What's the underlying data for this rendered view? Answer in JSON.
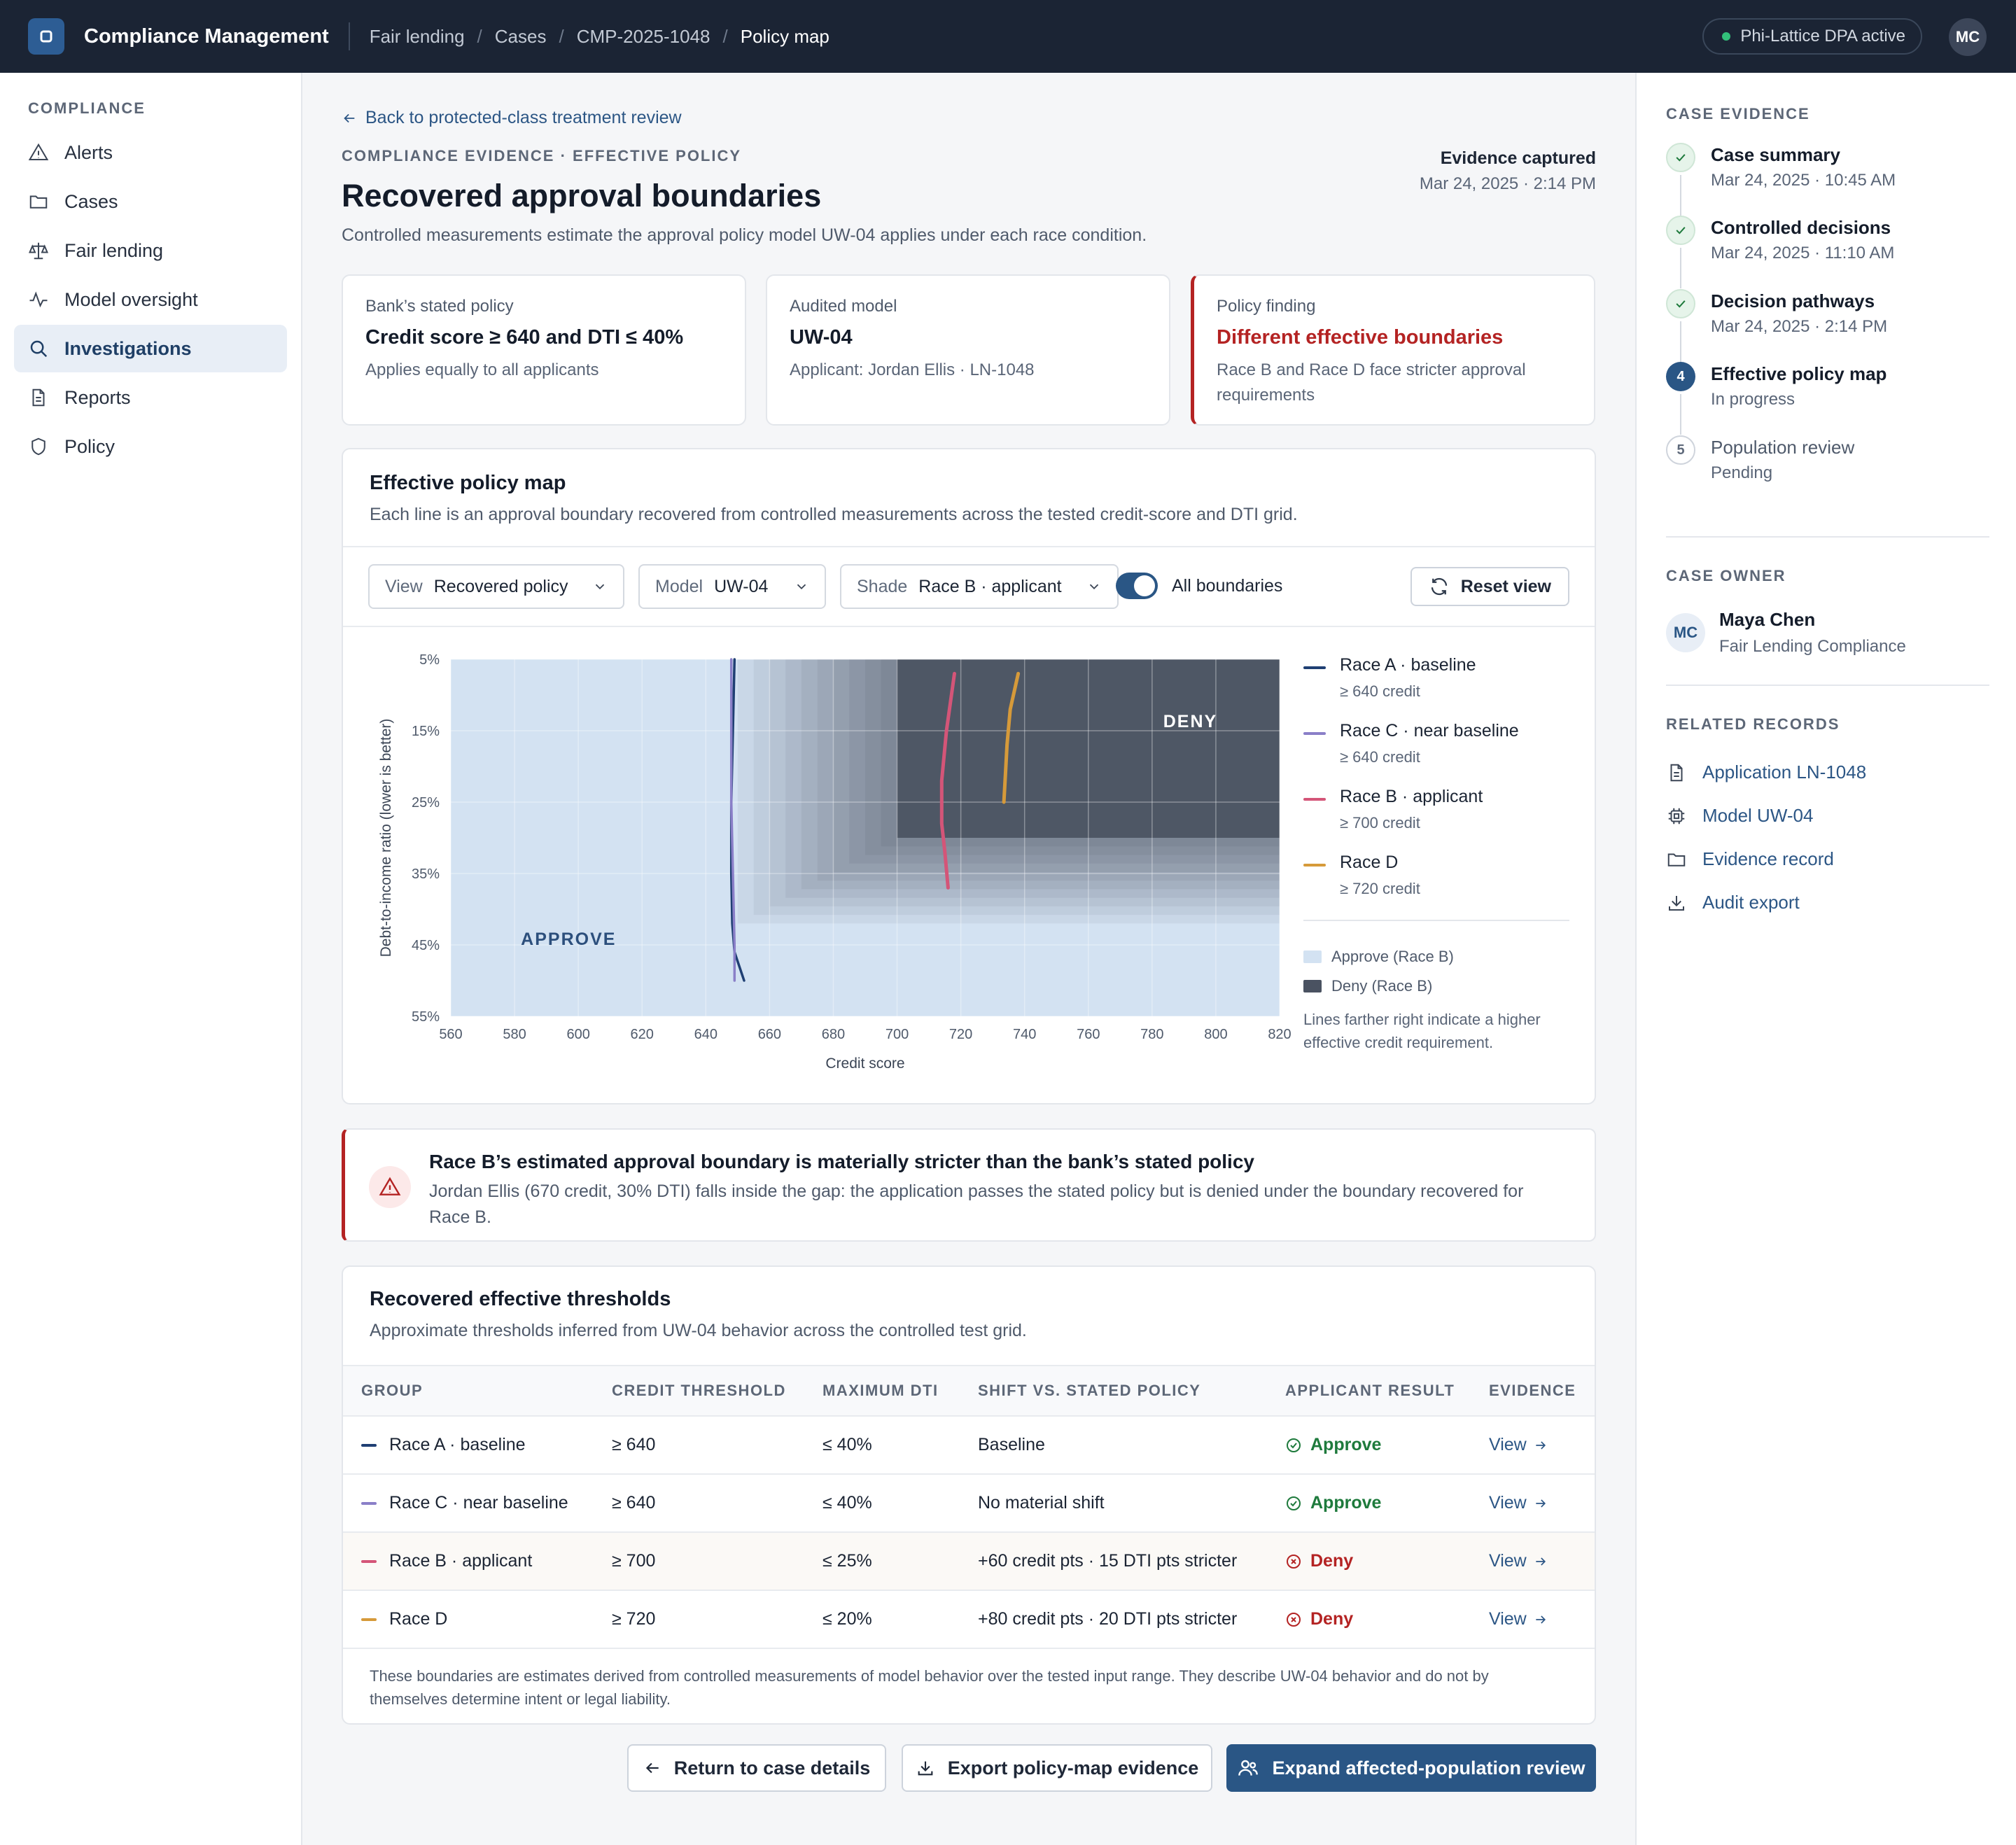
{
  "app": {
    "title": "Compliance Management"
  },
  "breadcrumbs": [
    "Fair lending",
    "Cases",
    "CMP-2025-1048",
    "Policy map"
  ],
  "status_pill": "Phi-Lattice DPA active",
  "user_initials": "MC",
  "sidebar": {
    "heading": "COMPLIANCE",
    "items": [
      {
        "label": "Alerts",
        "icon": "alert-triangle-icon"
      },
      {
        "label": "Cases",
        "icon": "folder-icon"
      },
      {
        "label": "Fair lending",
        "icon": "scale-icon"
      },
      {
        "label": "Model oversight",
        "icon": "activity-icon"
      },
      {
        "label": "Investigations",
        "icon": "search-icon",
        "active": true
      },
      {
        "label": "Reports",
        "icon": "document-icon"
      },
      {
        "label": "Policy",
        "icon": "shield-icon"
      }
    ]
  },
  "back_link": "Back to protected-class treatment review",
  "eyebrow": "COMPLIANCE EVIDENCE · EFFECTIVE POLICY",
  "page_title": "Recovered approval boundaries",
  "page_subtitle": "Controlled measurements estimate the approval policy model UW-04 applies under each race condition.",
  "evidence_captured": {
    "label": "Evidence captured",
    "date": "Mar 24, 2025 · 2:14 PM"
  },
  "summary_cards": [
    {
      "label": "Bank’s stated policy",
      "value": "Credit score ≥ 640 and DTI ≤ 40%",
      "sub": "Applies equally to all applicants"
    },
    {
      "label": "Audited model",
      "value": "UW-04",
      "sub": "Applicant: Jordan Ellis · LN-1048"
    },
    {
      "label": "Policy finding",
      "value": "Different effective boundaries",
      "sub": "Race B and Race D face stricter approval requirements"
    }
  ],
  "map_card": {
    "title": "Effective policy map",
    "subtitle": "Each line is an approval boundary recovered from controlled measurements across the tested credit-score and DTI grid.",
    "controls": {
      "view": {
        "key": "View",
        "value": "Recovered policy"
      },
      "model": {
        "key": "Model",
        "value": "UW-04"
      },
      "shade": {
        "key": "Shade",
        "value": "Race B · applicant"
      },
      "toggle_label": "All boundaries",
      "toggle_on": true,
      "reset_label": "Reset view"
    },
    "legend": {
      "items": [
        {
          "name": "Race A · baseline",
          "detail": "≥ 640 credit",
          "color": "#1f3f73"
        },
        {
          "name": "Race C · near baseline",
          "detail": "≥ 640 credit",
          "color": "#8a7fc8"
        },
        {
          "name": "Race B · applicant",
          "detail": "≥ 700 credit",
          "color": "#d45578"
        },
        {
          "name": "Race D",
          "detail": "≥ 720 credit",
          "color": "#d69a3a"
        }
      ],
      "approve_label": "Approve (Race B)",
      "deny_label": "Deny (Race B)",
      "approve_color": "#d3e2f2",
      "deny_color": "#4a5261",
      "note": "Lines farther right indicate a higher effective credit requirement."
    }
  },
  "chart_data": {
    "type": "line",
    "title": "",
    "xlabel": "Credit score",
    "ylabel": "Debt-to-income ratio (lower is better)",
    "xlim": [
      560,
      820
    ],
    "ylim": [
      5,
      55
    ],
    "y_inverted": true,
    "x_ticks": [
      "560",
      "580",
      "600",
      "620",
      "640",
      "660",
      "680",
      "700",
      "720",
      "740",
      "760",
      "780",
      "800",
      "820"
    ],
    "y_ticks": [
      "5%",
      "15%",
      "25%",
      "35%",
      "45%",
      "55%"
    ],
    "region_labels": {
      "approve": "APPROVE",
      "deny": "DENY"
    },
    "deny_region": {
      "credit_min": 700,
      "dti_max": 30
    },
    "series": [
      {
        "name": "Race A · baseline",
        "color": "#1f3f73",
        "x": [
          649,
          648.5,
          648,
          648,
          648.3,
          649,
          652
        ],
        "y": [
          5,
          15,
          25,
          35,
          42,
          46,
          50
        ]
      },
      {
        "name": "Race C · near baseline",
        "color": "#8a7fc8",
        "x": [
          648,
          648,
          648,
          648.5,
          649,
          649
        ],
        "y": [
          5,
          15,
          25,
          35,
          45,
          50
        ]
      },
      {
        "name": "Race B · applicant",
        "color": "#d45578",
        "x": [
          718,
          715.5,
          714,
          714,
          715,
          716
        ],
        "y": [
          7,
          15,
          22,
          28,
          32,
          37
        ]
      },
      {
        "name": "Race D",
        "color": "#d69a3a",
        "x": [
          738,
          735.5,
          734.5,
          734,
          733.5
        ],
        "y": [
          7,
          12,
          17,
          21,
          25
        ]
      }
    ]
  },
  "alert": {
    "title": "Race B’s estimated approval boundary is materially stricter than the bank’s stated policy",
    "body": "Jordan Ellis (670 credit, 30% DTI) falls inside the gap: the application passes the stated policy but is denied under the boundary recovered for Race B."
  },
  "thresholds": {
    "title": "Recovered effective thresholds",
    "subtitle": "Approximate thresholds inferred from UW-04 behavior across the controlled test grid.",
    "columns": [
      "GROUP",
      "CREDIT THRESHOLD",
      "MAXIMUM DTI",
      "SHIFT VS. STATED POLICY",
      "APPLICANT RESULT",
      "EVIDENCE"
    ],
    "rows": [
      {
        "group": "Race A · baseline",
        "color": "#1f3f73",
        "credit": "≥ 640",
        "dti": "≤ 40%",
        "shift": "Baseline",
        "result": "Approve",
        "status": "ok",
        "evidence": "View"
      },
      {
        "group": "Race C · near baseline",
        "color": "#8a7fc8",
        "credit": "≥ 640",
        "dti": "≤ 40%",
        "shift": "No material shift",
        "result": "Approve",
        "status": "ok",
        "evidence": "View"
      },
      {
        "group": "Race B · applicant",
        "color": "#d45578",
        "credit": "≥ 700",
        "dti": "≤ 25%",
        "shift": "+60 credit pts · 15 DTI pts stricter",
        "result": "Deny",
        "status": "bad",
        "evidence": "View"
      },
      {
        "group": "Race D",
        "color": "#d69a3a",
        "credit": "≥ 720",
        "dti": "≤ 20%",
        "shift": "+80 credit pts · 20 DTI pts stricter",
        "result": "Deny",
        "status": "bad",
        "evidence": "View"
      }
    ],
    "footnote": "These boundaries are estimates derived from controlled measurements of model behavior over the tested input range. They describe UW-04 behavior and do not by themselves determine intent or legal liability."
  },
  "actions": {
    "return": "Return to case details",
    "export": "Export policy-map evidence",
    "expand": "Expand affected-population review"
  },
  "right_panel": {
    "evidence_heading": "CASE EVIDENCE",
    "steps": [
      {
        "title": "Case summary",
        "sub": "Mar 24, 2025 · 10:45 AM",
        "state": "done"
      },
      {
        "title": "Controlled decisions",
        "sub": "Mar 24, 2025 · 11:10 AM",
        "state": "done"
      },
      {
        "title": "Decision pathways",
        "sub": "Mar 24, 2025 · 2:14 PM",
        "state": "done"
      },
      {
        "title": "Effective policy map",
        "sub": "In progress",
        "state": "current",
        "num": "4"
      },
      {
        "title": "Population review",
        "sub": "Pending",
        "state": "pending",
        "num": "5"
      }
    ],
    "owner_heading": "CASE OWNER",
    "owner": {
      "initials": "MC",
      "name": "Maya Chen",
      "role": "Fair Lending Compliance"
    },
    "related_heading": "RELATED RECORDS",
    "related": [
      {
        "label": "Application LN-1048",
        "icon": "document-icon"
      },
      {
        "label": "Model UW-04",
        "icon": "chip-icon"
      },
      {
        "label": "Evidence record",
        "icon": "folder-icon"
      },
      {
        "label": "Audit export",
        "icon": "download-icon"
      }
    ]
  }
}
